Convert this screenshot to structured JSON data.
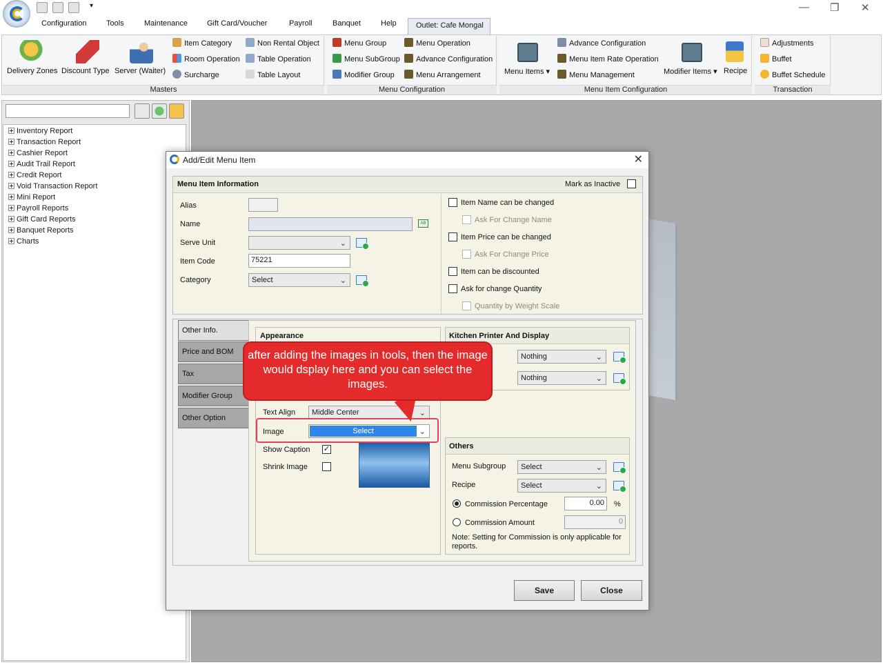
{
  "ribbon_tabs": [
    "Configuration",
    "Tools",
    "Maintenance",
    "Gift Card/Voucher",
    "Payroll",
    "Banquet",
    "Help"
  ],
  "active_tab": "Outlet: Cafe Mongal",
  "ribbon": {
    "masters": {
      "label": "Masters",
      "big": [
        "Delivery Zones",
        "Discount Type",
        "Server (Waiter)"
      ],
      "small": [
        "Item Category",
        "Room Operation",
        "Surcharge",
        "Non Rental Object",
        "Table Operation",
        "Table Layout"
      ]
    },
    "menu_config": {
      "label": "Menu Configuration",
      "small": [
        "Menu Group",
        "Menu SubGroup",
        "Modifier Group",
        "Menu Operation",
        "Advance Configuration",
        "Menu Arrangement"
      ]
    },
    "menu_item_config": {
      "label": "Menu Item Configuration",
      "big": [
        "Menu Items",
        "Modifier Items",
        "Recipe"
      ],
      "small": [
        "Advance Configuration",
        "Menu Item Rate Operation",
        "Menu Management"
      ]
    },
    "transaction": {
      "label": "Transaction",
      "small": [
        "Adjustments",
        "Buffet",
        "Buffet Schedule"
      ]
    }
  },
  "tree": [
    "Inventory Report",
    "Transaction Report",
    "Cashier Report",
    "Audit Trail Report",
    "Credit Report",
    "Void Transaction Report",
    "Mini Report",
    "Payroll Reports",
    "Gift Card Reports",
    "Banquet Reports",
    "Charts"
  ],
  "dialog": {
    "title": "Add/Edit Menu Item",
    "info_header": "Menu Item Information",
    "mark_inactive": "Mark as Inactive",
    "fields": {
      "alias_label": "Alias",
      "name_label": "Name",
      "serve_unit_label": "Serve Unit",
      "item_code_label": "Item Code",
      "item_code_value": "75221",
      "category_label": "Category",
      "category_value": "Select"
    },
    "options": [
      {
        "label": "Item Name can be changed",
        "enabled": true
      },
      {
        "label": "Ask For Change Name",
        "enabled": false
      },
      {
        "label": "Item Price can be changed",
        "enabled": true
      },
      {
        "label": "Ask For Change Price",
        "enabled": false
      },
      {
        "label": "Item can be discounted",
        "enabled": true
      },
      {
        "label": "Ask for change Quantity",
        "enabled": true
      },
      {
        "label": "Quantity by Weight Scale",
        "enabled": false
      }
    ],
    "side_tabs": [
      "Other Info.",
      "Price and BOM",
      "Tax",
      "Modifier Group",
      "Other Option"
    ],
    "appearance": {
      "header": "Appearance",
      "text_align_label": "Text Align",
      "text_align_value": "Middle Center",
      "image_label": "Image",
      "image_value": "Select",
      "show_caption_label": "Show Caption",
      "shrink_image_label": "Shrink Image"
    },
    "kitchen": {
      "header": "Kitchen Printer And Display",
      "printer_value": "Nothing",
      "display_value": "Nothing"
    },
    "others": {
      "header": "Others",
      "subgroup_label": "Menu Subgroup",
      "subgroup_value": "Select",
      "recipe_label": "Recipe",
      "recipe_value": "Select",
      "commission_pct_label": "Commission Percentage",
      "commission_pct_value": "0.00",
      "pct_symbol": "%",
      "commission_amt_label": "Commission Amount",
      "commission_amt_value": "0",
      "note": "Note: Setting for Commission is only applicable for reports."
    },
    "save": "Save",
    "close": "Close"
  },
  "callout": "after adding the images in tools, then the image would dsplay here and you can select the images."
}
